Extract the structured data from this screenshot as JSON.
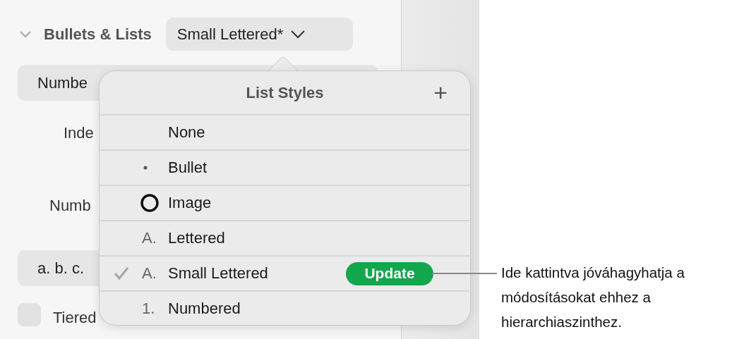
{
  "panel": {
    "section": {
      "title": "Bullets & Lists",
      "expanded": true
    },
    "style_button": "Small Lettered*",
    "list_type_button": "Numbe",
    "indent_label": "Inde",
    "number_label": "Numb",
    "format_button": "a. b. c.",
    "tiered": {
      "label": "Tiered",
      "checked": false
    }
  },
  "popover": {
    "title": "List Styles",
    "add_button": "+",
    "items": [
      {
        "kind": "plain",
        "label": "None",
        "selected": false
      },
      {
        "kind": "bullet",
        "label": "Bullet",
        "selected": false
      },
      {
        "kind": "image",
        "label": "Image",
        "selected": false
      },
      {
        "kind": "text",
        "marker": "A.",
        "label": "Lettered",
        "selected": false
      },
      {
        "kind": "text",
        "marker": "A.",
        "label": "Small Lettered",
        "selected": true,
        "update_button": "Update"
      },
      {
        "kind": "text",
        "marker": "1.",
        "label": "Numbered",
        "selected": false
      }
    ]
  },
  "callout": "Ide kattintva jóváhagyhatja a módosításokat ehhez a hierarchiaszinthez."
}
